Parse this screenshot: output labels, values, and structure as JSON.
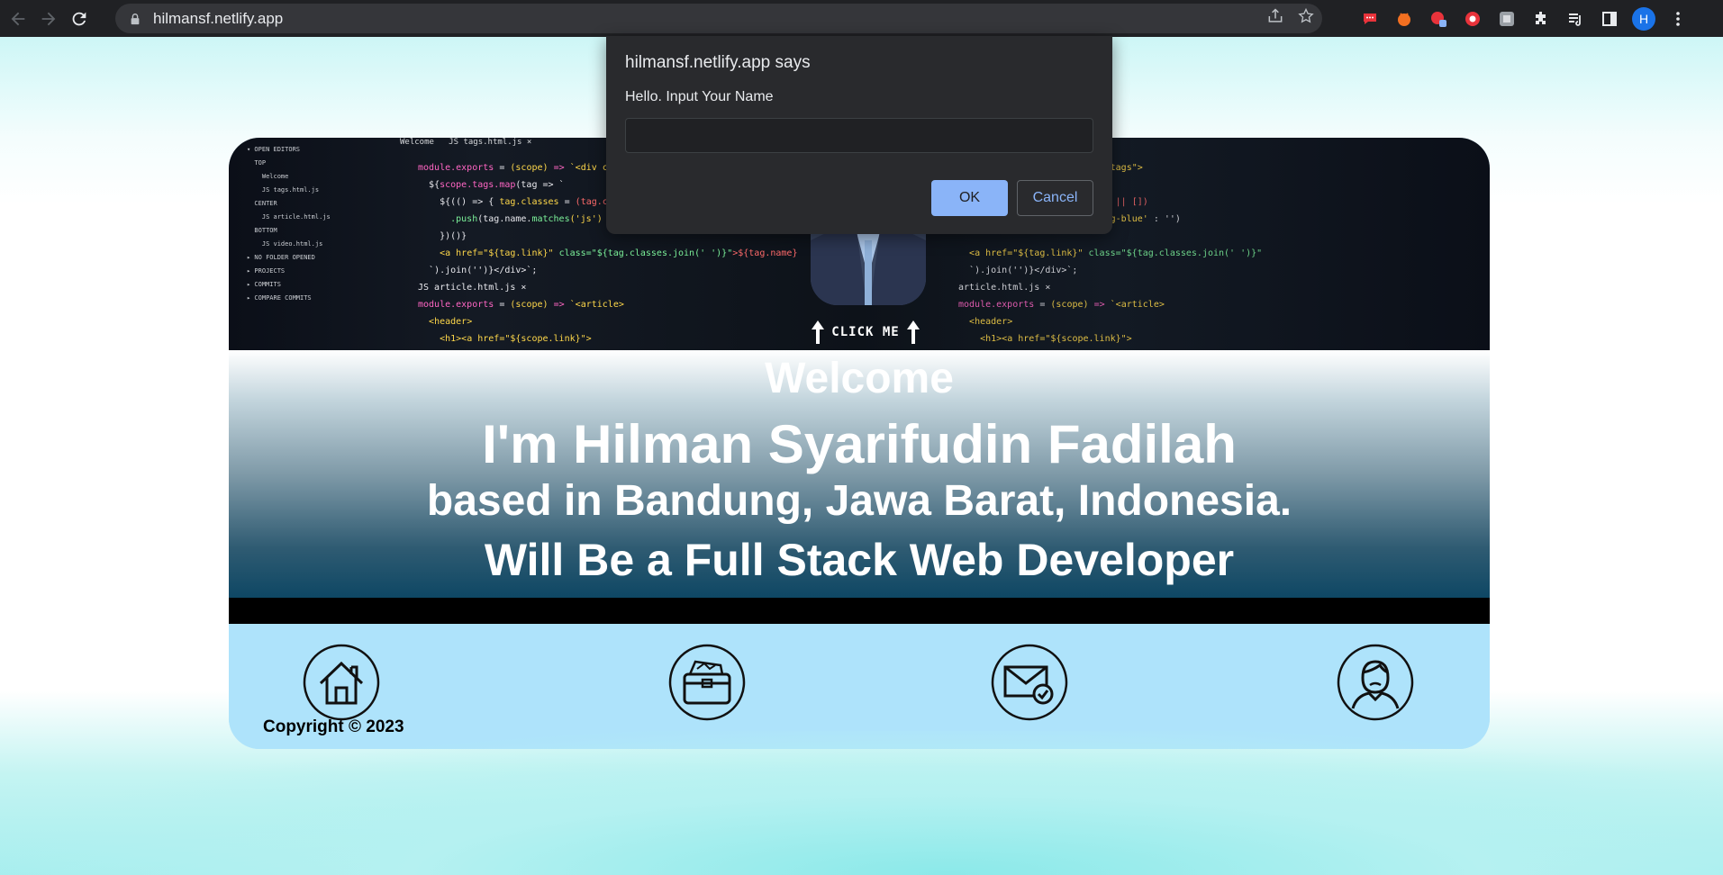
{
  "browser": {
    "url": "hilmansf.netlify.app",
    "profile_initial": "H",
    "icons": [
      "back-icon",
      "forward-icon",
      "reload-icon",
      "lock-icon",
      "share-icon",
      "star-icon",
      "extensions-icon",
      "reading-list-icon",
      "side-panel-icon",
      "menu-icon"
    ]
  },
  "page": {
    "hero": {
      "click_me": "CLICK ME"
    },
    "banner": {
      "line1": "Welcome",
      "line2": "I'm Hilman Syarifudin Fadilah",
      "line3": "based in Bandung, Jawa Barat, Indonesia.",
      "line4": "Will Be a Full Stack Web Developer"
    },
    "nav_icons": [
      "home-icon",
      "portfolio-icon",
      "contact-icon",
      "about-icon"
    ],
    "copyright": "Copyright © 2023"
  },
  "dialog": {
    "title": "hilmansf.netlify.app says",
    "message": "Hello. Input Your Name",
    "input_value": "",
    "ok_label": "OK",
    "cancel_label": "Cancel"
  },
  "colors": {
    "chrome_bg": "#202124",
    "dialog_bg": "#292a2d",
    "ok_button": "#8ab4f8",
    "icon_bar_bg": "#aee3fb"
  }
}
